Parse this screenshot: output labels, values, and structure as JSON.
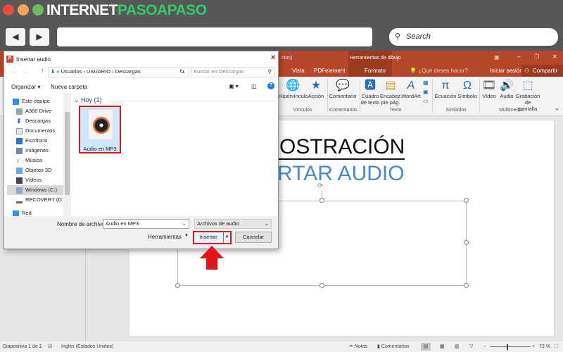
{
  "browser": {
    "logo_white": "INTERNET",
    "logo_green": "PASOAPASO",
    "search_placeholder": "Search",
    "colors": {
      "red": "#e94b3c",
      "orange": "#f0a35a",
      "green": "#6dbb5e"
    }
  },
  "ppt": {
    "title_partial": "ctos)",
    "contextual_tab_group": "Herramientas de dibujo",
    "tabs": [
      "Vista",
      "PDFelement",
      "Formato"
    ],
    "tell_me": "¿Qué desea hacer?",
    "sign_in": "Iniciar sesión",
    "share": "Compartir",
    "ribbon": {
      "buttons": [
        "Hipervínculo",
        "Acción",
        "Comentario",
        "Cuadro de texto",
        "Encabez. pie pág.",
        "WordArt",
        "Ecuación",
        "Símbolo",
        "Vídeo",
        "Audio",
        "Grabación de pantalla"
      ],
      "groups": [
        "Vínculos",
        "Comentarios",
        "Texto",
        "Símbolos",
        "Multimedia"
      ]
    },
    "slide": {
      "title": "MOSTRACIÓN",
      "subtitle": "ERTAR AUDIO"
    },
    "status": {
      "slide": "Diapositiva 1 de 1",
      "language": "Inglés (Estados Unidos)",
      "notes": "Notas",
      "comments": "Comentarios",
      "zoom": "73 %",
      "zoom_percent": 73
    }
  },
  "dialog": {
    "title": "Insertar audio",
    "breadcrumb": [
      "«",
      "Usuarios",
      "USUARIO",
      "Descargas"
    ],
    "search_placeholder": "Buscar en Descargas",
    "organize": "Organizar ▾",
    "new_folder": "Nueva carpeta",
    "nav": [
      "Este equipo",
      "A360 Drive",
      "Descargas",
      "Documentos",
      "Escritorio",
      "Imágenes",
      "Música",
      "Objetos 3D",
      "Vídeos",
      "Windows (C:)",
      "RECOVERY (D:)",
      "Red"
    ],
    "group_header": "Hoy (1)",
    "file": "Audio en MP3",
    "filename_label": "Nombre de archivo:",
    "filename_value": "Audio en MP3",
    "filetype": "Archivos de audio",
    "tools": "Herramientas",
    "insert": "Insertar",
    "cancel": "Cancelar"
  }
}
